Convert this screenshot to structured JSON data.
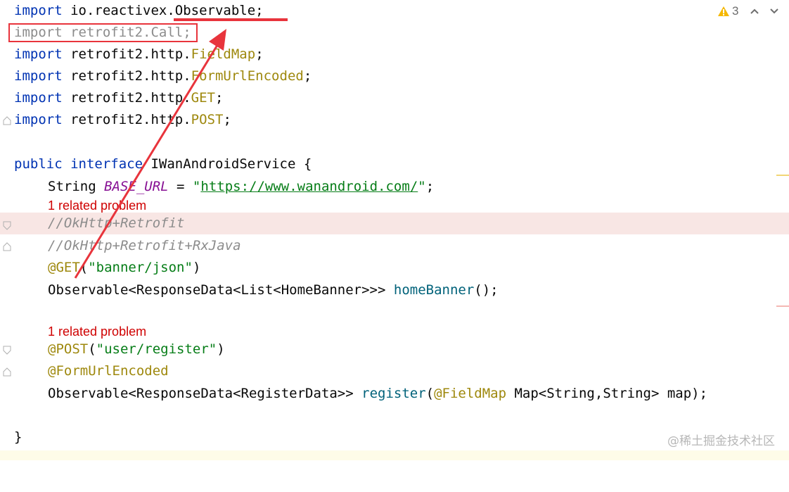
{
  "editor": {
    "inspection": {
      "warning_count": "3",
      "warning_color": "#f5b800"
    },
    "lines": {
      "l1": {
        "kw": "import",
        "rest": " io.reactivex.Observable;"
      },
      "l2": {
        "text": "import retrofit2.Call;"
      },
      "l3": {
        "kw": "import",
        "pre": " retrofit2.http.",
        "ann": "FieldMap",
        "end": ";"
      },
      "l4": {
        "kw": "import",
        "pre": " retrofit2.http.",
        "ann": "FormUrlEncoded",
        "end": ";"
      },
      "l5": {
        "kw": "import",
        "pre": " retrofit2.http.",
        "ann": "GET",
        "end": ";"
      },
      "l6": {
        "kw": "import",
        "pre": " retrofit2.http.",
        "ann": "POST",
        "end": ";"
      },
      "l7": {
        "kw1": "public",
        "kw2": "interface",
        "name": " IWanAndroidService {"
      },
      "l8": {
        "type": "String ",
        "const": "BASE_URL",
        "eq": " = ",
        "q1": "\"",
        "url": "https://www.wanandroid.com/",
        "q2": "\"",
        "end": ";"
      },
      "l9": {
        "comment": "//OkHttp+Retrofit"
      },
      "l10": {
        "comment": "//OkHttp+Retrofit+RxJava"
      },
      "l11": {
        "ann": "@GET",
        "open": "(",
        "str": "\"banner/json\"",
        "close": ")"
      },
      "l12": {
        "type": "Observable<ResponseData<List<HomeBanner>>> ",
        "fn": "homeBanner",
        "end": "();"
      },
      "l13": {
        "ann": "@POST",
        "open": "(",
        "str": "\"user/register\"",
        "close": ")"
      },
      "l14": {
        "ann": "@FormUrlEncoded"
      },
      "l15": {
        "type": "Observable<ResponseData<RegisterData>> ",
        "fn": "register",
        "open": "(",
        "ann": "@FieldMap",
        "rest": " Map<String,String> map);"
      },
      "l16": {
        "text": "}"
      }
    },
    "inlay_hints": [
      "1 related problem",
      "1 related problem"
    ]
  },
  "annotation_colors": {
    "markup": "#e8343c"
  },
  "watermark": "@稀土掘金技术社区"
}
